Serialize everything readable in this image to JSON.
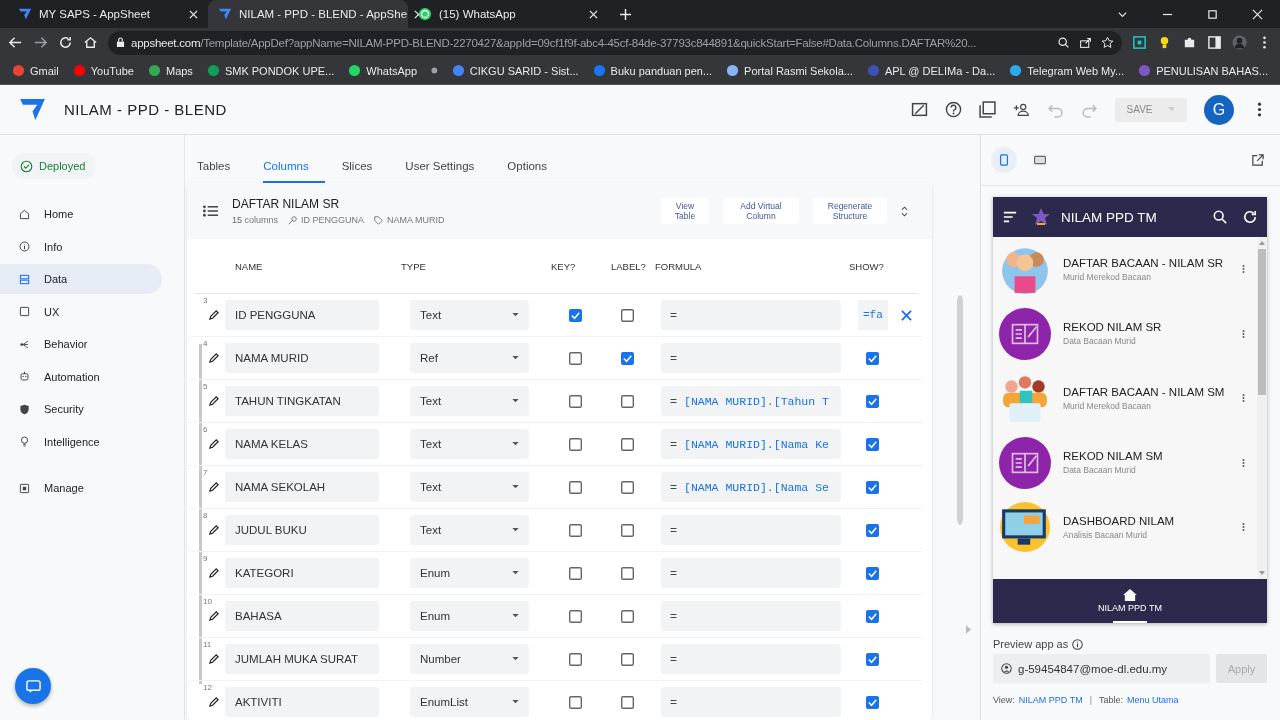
{
  "browser": {
    "tabs": [
      {
        "title": "MY SAPS - AppSheet",
        "selected": false,
        "kind": "appsheet"
      },
      {
        "title": "NILAM - PPD - BLEND - AppShe",
        "selected": true,
        "kind": "appsheet"
      },
      {
        "title": "(15) WhatsApp",
        "selected": false,
        "kind": "whatsapp"
      }
    ],
    "url_host": "appsheet.com",
    "url_path": "/Template/AppDef?appName=NILAM-PPD-BLEND-2270427&appId=09cf1f9f-abc4-45cf-84de-37793c844891&quickStart=False#Data.Columns.DAFTAR%20...",
    "bookmarks": [
      {
        "label": "Gmail",
        "color": "#ea4335"
      },
      {
        "label": "YouTube",
        "color": "#ff0000"
      },
      {
        "label": "Maps",
        "color": "#34a853"
      },
      {
        "label": "SMK PONDOK UPE...",
        "color": "#0f9d58"
      },
      {
        "label": "WhatsApp",
        "color": "#25d366"
      },
      {
        "color": "#9aa0a6"
      },
      {
        "label": "CIKGU SARID - Sist...",
        "color": "#4285f4"
      },
      {
        "label": "Buku panduan pen...",
        "color": "#1877f2"
      },
      {
        "label": "Portal Rasmi Sekola...",
        "color": "#8ab4f8"
      },
      {
        "label": "APL @ DELIMa - Da...",
        "color": "#3f51b5"
      },
      {
        "label": "Telegram Web My...",
        "color": "#2aabee"
      },
      {
        "label": "PENULISAN BAHAS...",
        "color": "#7e57c2"
      }
    ]
  },
  "app": {
    "title": "NILAM - PPD - BLEND",
    "save": "SAVE",
    "avatar": "G"
  },
  "status": "Deployed",
  "nav": [
    {
      "label": "Home",
      "kind": "home",
      "selected": false
    },
    {
      "label": "Info",
      "kind": "info",
      "selected": false
    },
    {
      "label": "Data",
      "kind": "data",
      "selected": true
    },
    {
      "label": "UX",
      "kind": "ux",
      "selected": false
    },
    {
      "label": "Behavior",
      "kind": "behavior",
      "selected": false
    },
    {
      "label": "Automation",
      "kind": "automation",
      "selected": false
    },
    {
      "label": "Security",
      "kind": "security",
      "selected": false
    },
    {
      "label": "Intelligence",
      "kind": "intelligence",
      "selected": false
    },
    {
      "label": "Manage",
      "kind": "manage",
      "selected": false
    }
  ],
  "tabs": [
    {
      "label": "Tables",
      "selected": false
    },
    {
      "label": "Columns",
      "selected": true
    },
    {
      "label": "Slices",
      "selected": false
    },
    {
      "label": "User Settings",
      "selected": false
    },
    {
      "label": "Options",
      "selected": false
    }
  ],
  "table": {
    "name": "DAFTAR NILAM SR",
    "count": "15",
    "count_unit": "columns",
    "key": "ID PENGGUNA",
    "label": "NAMA MURID",
    "actions": [
      "View Table",
      "Add Virtual Column",
      "Regenerate Structure"
    ],
    "headers": [
      "NAME",
      "TYPE",
      "KEY?",
      "LABEL?",
      "FORMULA",
      "SHOW?"
    ],
    "rows": [
      {
        "number": "3",
        "name": "ID PENGGUNA",
        "type": "Text",
        "key": true,
        "label": false,
        "formula": "=",
        "kind": "formula",
        "show_formula": "=fa"
      },
      {
        "number": "4",
        "name": "NAMA MURID",
        "type": "Ref",
        "key": false,
        "label": true,
        "formula": "=",
        "kind": "checkbox",
        "show": true
      },
      {
        "number": "5",
        "name": "TAHUN TINGKATAN",
        "type": "Text",
        "key": false,
        "label": false,
        "formula": "=",
        "expression": "[NAMA MURID].[Tahun T",
        "kind": "checkbox",
        "show": true
      },
      {
        "number": "6",
        "name": "NAMA KELAS",
        "type": "Text",
        "key": false,
        "label": false,
        "formula": "=",
        "expression": "[NAMA MURID].[Nama Ke",
        "kind": "checkbox",
        "show": true
      },
      {
        "number": "7",
        "name": "NAMA SEKOLAH",
        "type": "Text",
        "key": false,
        "label": false,
        "formula": "=",
        "expression": "[NAMA MURID].[Nama Se",
        "kind": "checkbox",
        "show": true
      },
      {
        "number": "8",
        "name": "JUDUL BUKU",
        "type": "Text",
        "key": false,
        "label": false,
        "formula": "=",
        "kind": "checkbox",
        "show": true
      },
      {
        "number": "9",
        "name": "KATEGORI",
        "type": "Enum",
        "key": false,
        "label": false,
        "formula": "=",
        "kind": "checkbox",
        "show": true
      },
      {
        "number": "10",
        "name": "BAHASA",
        "type": "Enum",
        "key": false,
        "label": false,
        "formula": "=",
        "kind": "checkbox",
        "show": true
      },
      {
        "number": "11",
        "name": "JUMLAH MUKA SURAT",
        "type": "Number",
        "key": false,
        "label": false,
        "formula": "=",
        "kind": "checkbox",
        "show": true
      },
      {
        "number": "12",
        "name": "AKTIVITI",
        "type": "EnumList",
        "key": false,
        "label": false,
        "formula": "=",
        "kind": "checkbox",
        "show": true
      }
    ]
  },
  "preview": {
    "devices": [
      {
        "kind": "phone",
        "selected": true
      },
      {
        "kind": "tablet",
        "selected": false
      }
    ],
    "app_title": "NILAM PPD TM",
    "items": [
      {
        "title": "DAFTAR BACAAN - NILAM SR",
        "subtitle": "Murid Merekod Bacaan",
        "kind": "children"
      },
      {
        "title": "REKOD NILAM SR",
        "subtitle": "Data Bacaan Murid",
        "kind": "book"
      },
      {
        "title": "DAFTAR BACAAN - NILAM SM",
        "subtitle": "Murid Merekod Bacaan",
        "kind": "people"
      },
      {
        "title": "REKOD NILAM SM",
        "subtitle": "Data Bacaan Murid",
        "kind": "book"
      },
      {
        "title": "DASHBOARD NILAM",
        "subtitle": "Analisis Bacaan Murid",
        "kind": "computer"
      }
    ],
    "bottom_nav": "NILAM PPD TM",
    "preview_as_label": "Preview app as",
    "preview_as_value": "g-59454847@moe-dl.edu.my",
    "apply": "Apply",
    "view_label": "View:",
    "view_value": "NILAM PPD TM",
    "separator": "|",
    "table_label": "Table:",
    "table_value": "Menu Utama"
  }
}
